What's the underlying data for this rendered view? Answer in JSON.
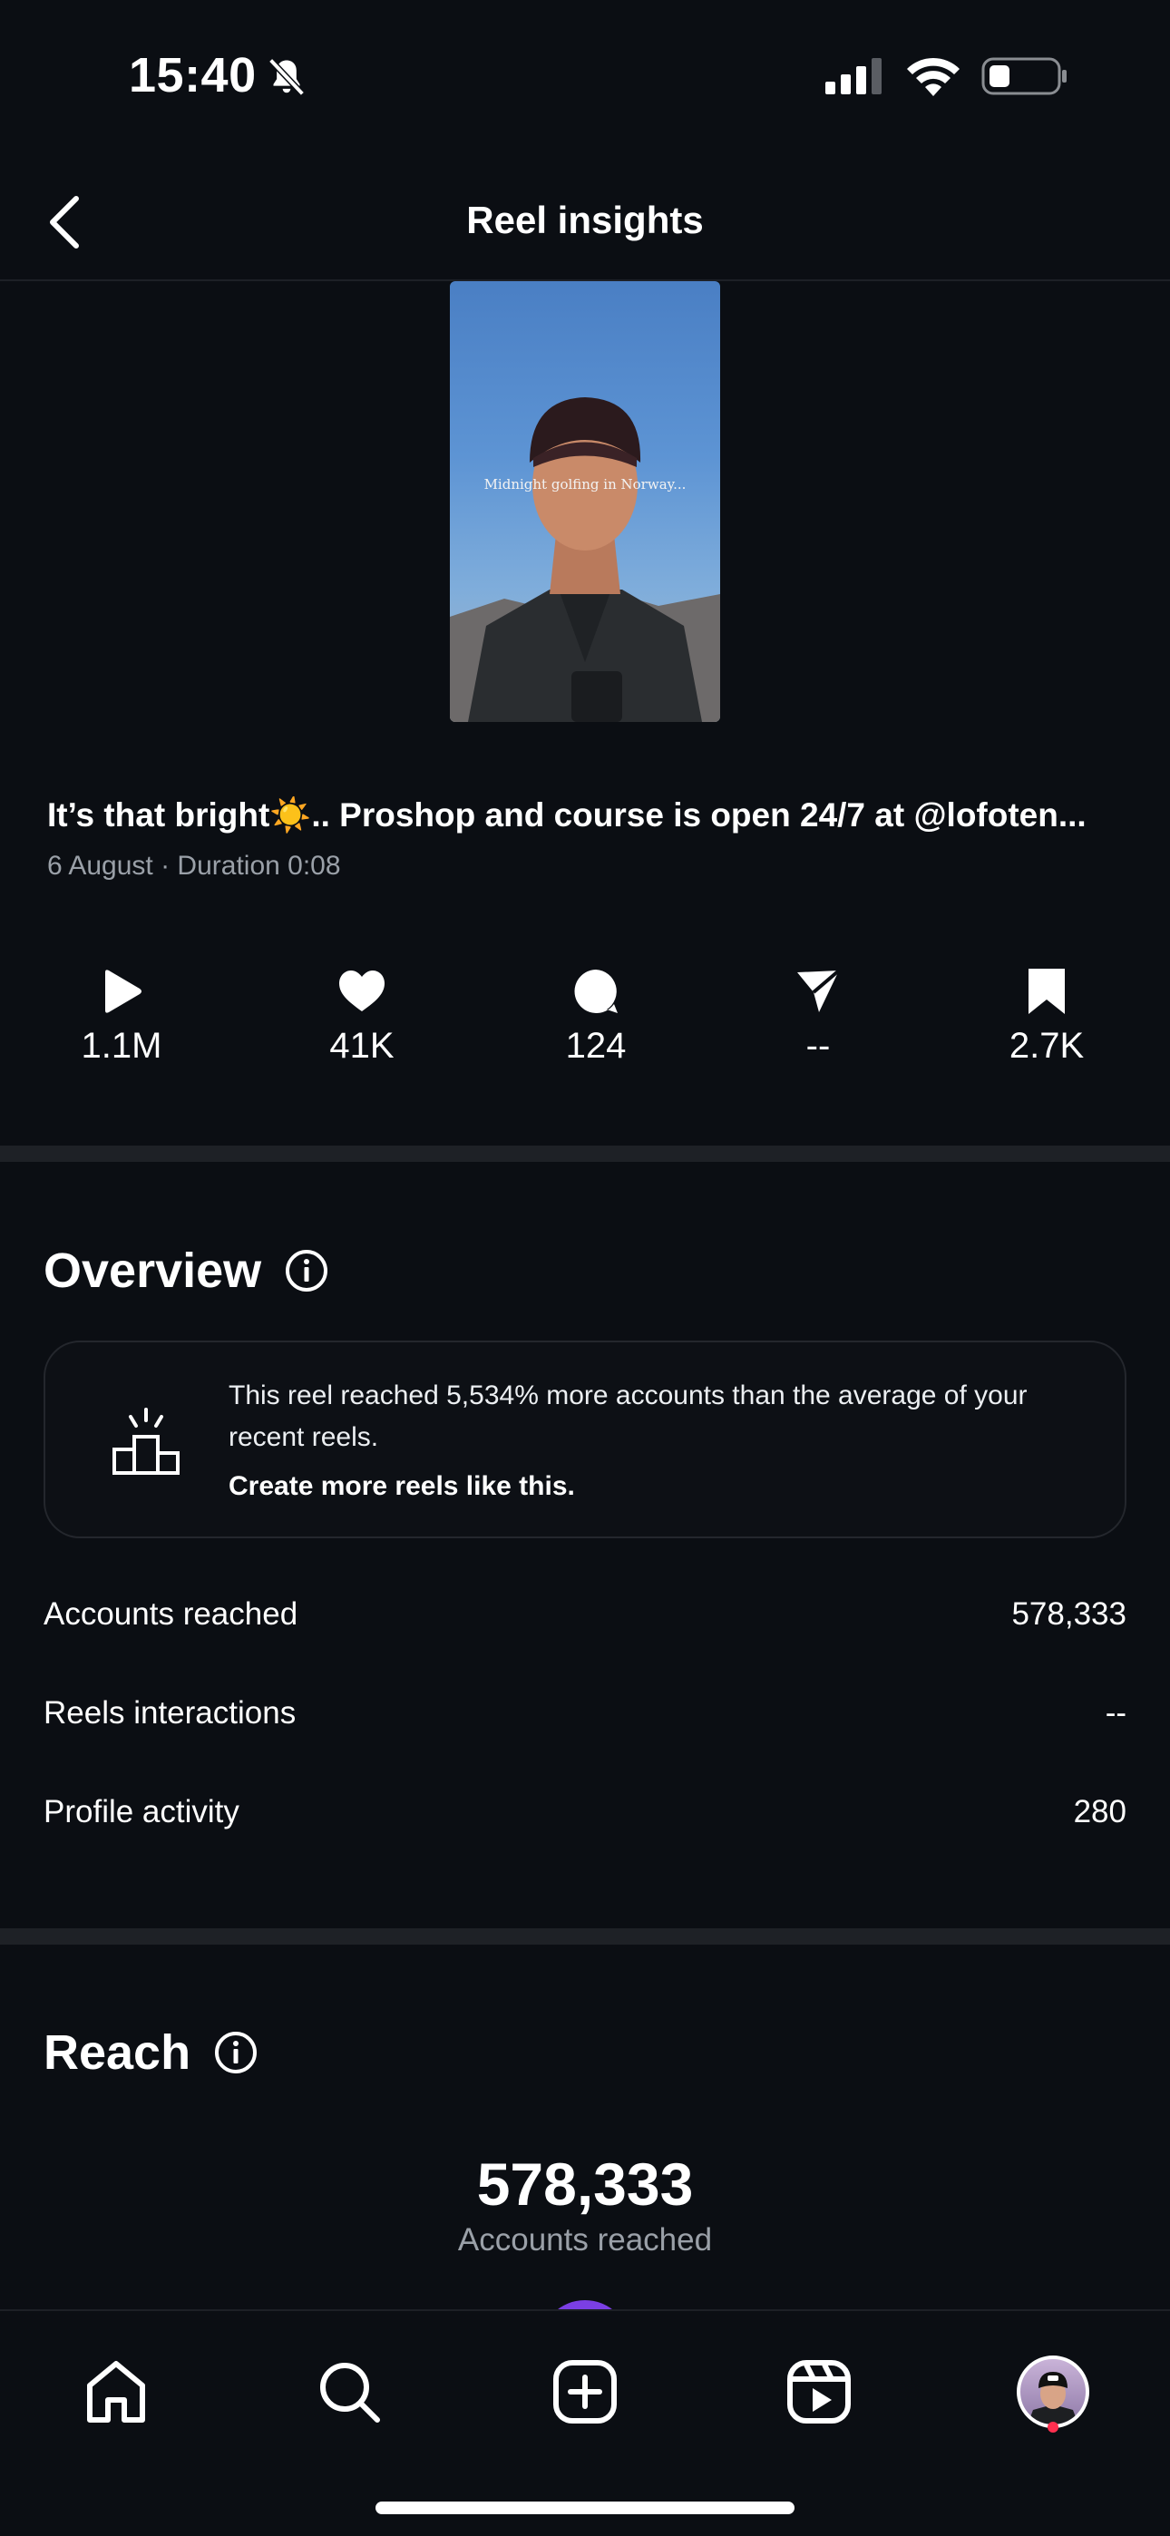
{
  "status_bar": {
    "time": "15:40"
  },
  "header": {
    "title": "Reel insights"
  },
  "reel": {
    "thumbnail_overlay_text": "Midnight golfing in Norway...",
    "caption": "It’s that bright☀️.. Proshop and course is open 24/7 at @lofoten...",
    "meta": "6 August · Duration 0:08"
  },
  "stats": [
    {
      "icon": "play-icon",
      "value": "1.1M"
    },
    {
      "icon": "heart-icon",
      "value": "41K"
    },
    {
      "icon": "comment-icon",
      "value": "124"
    },
    {
      "icon": "share-icon",
      "value": "--"
    },
    {
      "icon": "bookmark-icon",
      "value": "2.7K"
    }
  ],
  "overview": {
    "title": "Overview",
    "card": {
      "text": "This reel reached 5,534% more accounts than the average of your recent reels.",
      "cta": "Create more reels like this."
    },
    "metrics": [
      {
        "label": "Accounts reached",
        "value": "578,333"
      },
      {
        "label": "Reels interactions",
        "value": "--"
      },
      {
        "label": "Profile activity",
        "value": "280"
      }
    ]
  },
  "reach": {
    "title": "Reach",
    "number": "578,333",
    "label": "Accounts reached"
  },
  "colors": {
    "background": "#0b0e13",
    "divider": "#1e2126",
    "muted_text": "#9aa0a8",
    "accent_purple": "#7b3fe4",
    "notification_dot": "#ff2f4f"
  }
}
